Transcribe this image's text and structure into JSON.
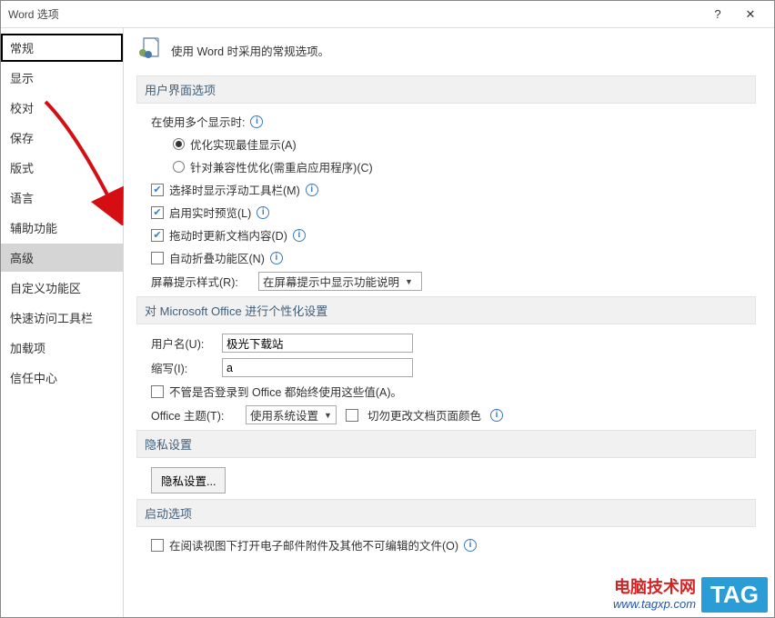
{
  "title": "Word 选项",
  "help_btn": "?",
  "close_btn": "✕",
  "sidebar": {
    "items": [
      {
        "label": "常规",
        "strong": true
      },
      {
        "label": "显示"
      },
      {
        "label": "校对"
      },
      {
        "label": "保存"
      },
      {
        "label": "版式"
      },
      {
        "label": "语言"
      },
      {
        "label": "辅助功能"
      },
      {
        "label": "高级",
        "selected": true
      },
      {
        "label": "自定义功能区"
      },
      {
        "label": "快速访问工具栏"
      },
      {
        "label": "加载项"
      },
      {
        "label": "信任中心"
      }
    ]
  },
  "header_text": "使用 Word 时采用的常规选项。",
  "section_ui": {
    "title": "用户界面选项",
    "multi_display_label": "在使用多个显示时:",
    "radio_optimize": "优化实现最佳显示(A)",
    "radio_compat": "针对兼容性优化(需重启应用程序)(C)",
    "chk_float_toolbar": "选择时显示浮动工具栏(M)",
    "chk_live_preview": "启用实时预览(L)",
    "chk_drag_update": "拖动时更新文档内容(D)",
    "chk_collapse": "自动折叠功能区(N)",
    "screentip_label": "屏幕提示样式(R):",
    "screentip_value": "在屏幕提示中显示功能说明"
  },
  "section_personal": {
    "title": "对 Microsoft Office 进行个性化设置",
    "username_label": "用户名(U):",
    "username_value": "极光下载站",
    "initials_label": "缩写(I):",
    "initials_value": "a",
    "chk_always_use": "不管是否登录到 Office 都始终使用这些值(A)。",
    "theme_label": "Office 主题(T):",
    "theme_value": "使用系统设置",
    "chk_no_bg_change": "切勿更改文档页面颜色"
  },
  "section_privacy": {
    "title": "隐私设置",
    "btn": "隐私设置..."
  },
  "section_startup": {
    "title": "启动选项",
    "chk_reading_view": "在阅读视图下打开电子邮件附件及其他不可编辑的文件(O)"
  },
  "watermark": {
    "line1": "电脑技术网",
    "url": "www.tagxp.com",
    "tag": "TAG"
  }
}
